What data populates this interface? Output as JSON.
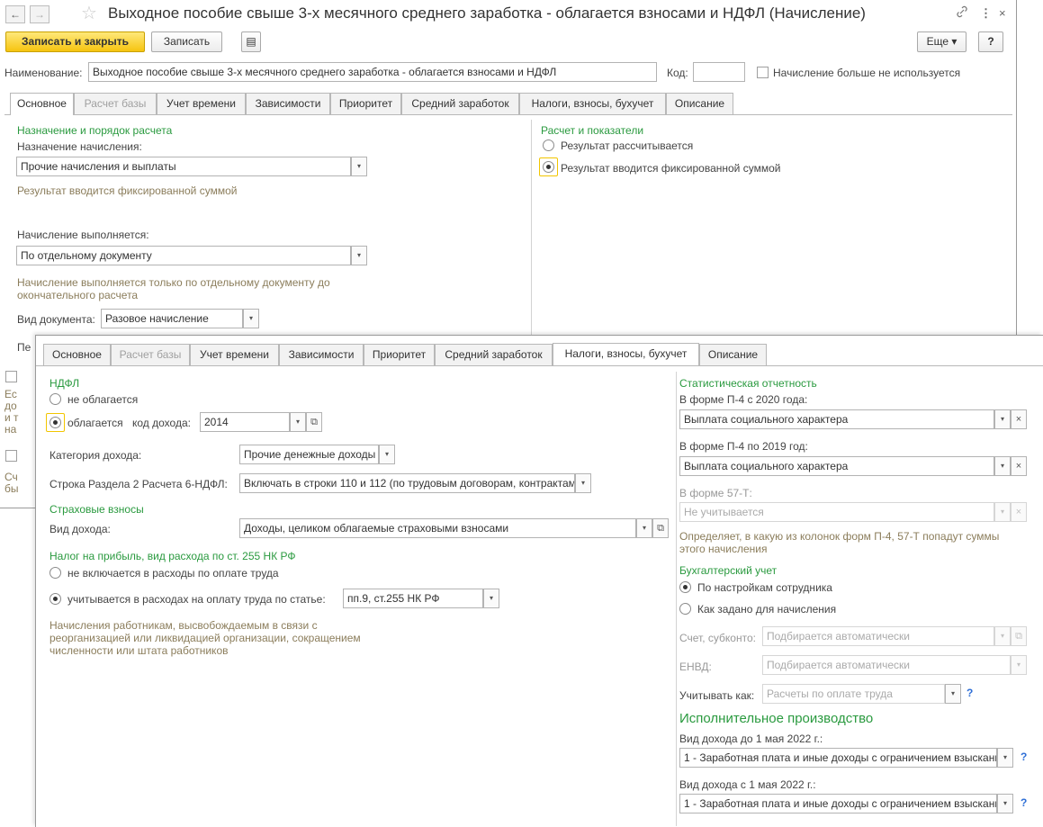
{
  "window1": {
    "title": "Выходное пособие свыше 3-х месячного среднего заработка - облагается взносами и НДФЛ (Начисление)",
    "nav_back": "←",
    "nav_forward": "→",
    "star": "☆",
    "link_icon": "🔗",
    "menu_icon": "⋮",
    "close_icon": "×",
    "toolbar": {
      "save_close": "Записать и закрыть",
      "save": "Записать",
      "more": "Еще ▾",
      "help": "?"
    },
    "name_label": "Наименование:",
    "name_value": "Выходное пособие свыше 3-х месячного среднего заработка - облагается взносами и НДФЛ",
    "code_label": "Код:",
    "code_value": "",
    "unused_label": "Начисление больше не используется",
    "tabs": [
      "Основное",
      "Расчет базы",
      "Учет времени",
      "Зависимости",
      "Приоритет",
      "Средний заработок",
      "Налоги, взносы, бухучет",
      "Описание"
    ],
    "left": {
      "section": "Назначение и порядок расчета",
      "purpose_label": "Назначение начисления:",
      "purpose_value": "Прочие начисления и выплаты",
      "purpose_note": "Результат вводится фиксированной суммой",
      "exec_label": "Начисление выполняется:",
      "exec_value": "По отдельному документу",
      "exec_note": "Начисление выполняется только по отдельному документу до окончательного расчета",
      "doc_label": "Вид документа:",
      "doc_value": "Разовое начисление",
      "cut_pe": "Пе",
      "cut_lines": [
        "Ес",
        "до",
        "и т",
        "на"
      ],
      "cut_lines2": [
        "Сч",
        "бы"
      ]
    },
    "right": {
      "section": "Расчет и показатели",
      "opt1": "Результат рассчитывается",
      "opt2": "Результат вводится фиксированной суммой"
    }
  },
  "window2": {
    "tabs": [
      "Основное",
      "Расчет базы",
      "Учет времени",
      "Зависимости",
      "Приоритет",
      "Средний заработок",
      "Налоги, взносы, бухучет",
      "Описание"
    ],
    "left": {
      "ndfl_section": "НДФЛ",
      "ndfl_opt1": "не облагается",
      "ndfl_opt2": "облагается",
      "income_code_label": "код дохода:",
      "income_code_value": "2014",
      "category_label": "Категория дохода:",
      "category_value": "Прочие денежные доходы",
      "row6_label": "Строка Раздела 2 Расчета 6-НДФЛ:",
      "row6_value": "Включать в строки 110 и 112 (по трудовым договорам, контрактам)",
      "ins_section": "Страховые взносы",
      "ins_label": "Вид дохода:",
      "ins_value": "Доходы, целиком облагаемые страховыми взносами",
      "profit_section": "Налог на прибыль, вид расхода по ст. 255 НК РФ",
      "profit_opt1": "не включается в расходы по оплате труда",
      "profit_opt2": "учитывается в расходах на оплату труда по статье:",
      "profit_value": "пп.9, ст.255 НК РФ",
      "profit_note": "Начисления работникам, высвобождаемым в связи с реорганизацией или ликвидацией организации, сокращением численности или штата работников"
    },
    "right": {
      "stat_section": "Статистическая отчетность",
      "p4_2020_label": "В форме П-4 с 2020 года:",
      "p4_2020_value": "Выплата социального характера",
      "p4_2019_label": "В форме П-4 по 2019 год:",
      "p4_2019_value": "Выплата социального характера",
      "f57_label": "В форме 57-Т:",
      "f57_value": "Не учитывается",
      "stat_note": "Определяет, в какую из колонок форм П-4, 57-Т попадут суммы этого начисления",
      "acc_section": "Бухгалтерский учет",
      "acc_opt1": "По настройкам сотрудника",
      "acc_opt2": "Как задано для начисления",
      "account_label": "Счет, субконто:",
      "account_value": "Подбирается автоматически",
      "envd_label": "ЕНВД:",
      "envd_value": "Подбирается автоматически",
      "treat_label": "Учитывать как:",
      "treat_value": "Расчеты по оплате труда",
      "exec_section": "Исполнительное производство",
      "before_label": "Вид дохода до 1 мая 2022 г.:",
      "before_value": "1 - Заработная плата и иные доходы с ограничением взыскания",
      "after_label": "Вид дохода с 1 мая 2022 г.:",
      "after_value": "1 - Заработная плата и иные доходы с ограничением взыскания",
      "help": "?"
    }
  },
  "icons": {
    "dropdown": "▾",
    "clear": "×",
    "open": "⧉",
    "report": "▤"
  }
}
